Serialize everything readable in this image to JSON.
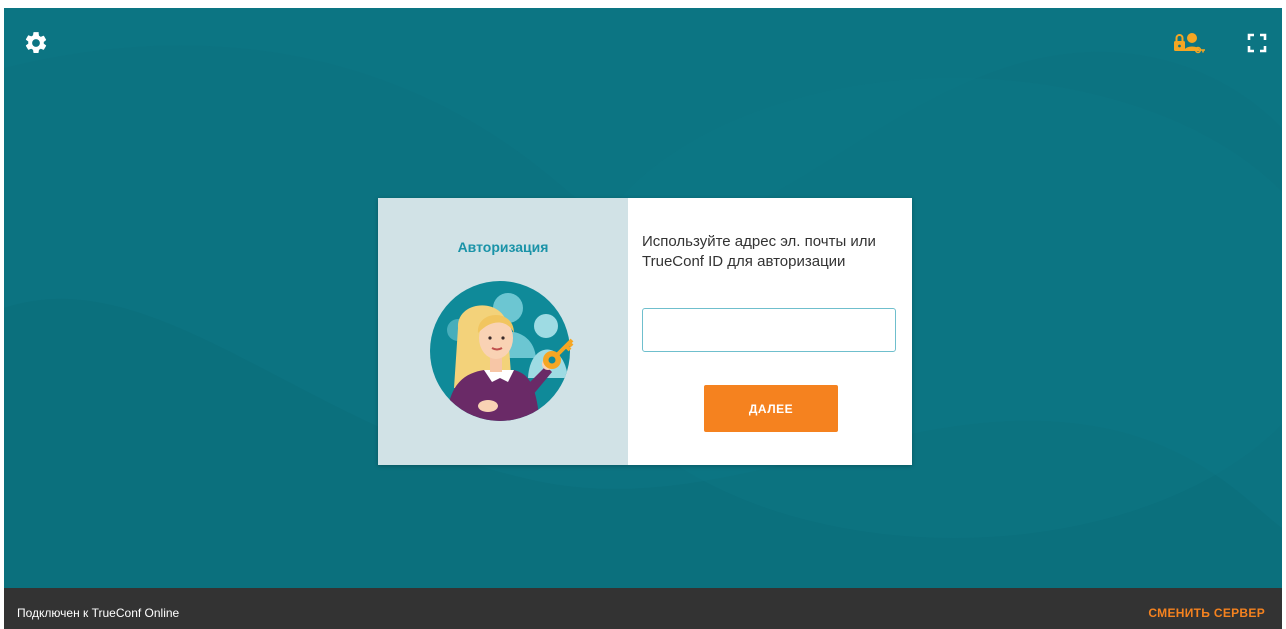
{
  "colors": {
    "background": "#0c7381",
    "accent": "#f5821f",
    "card_left_bg": "#d1e2e6",
    "title_color": "#1a93a8",
    "status_bar": "#333333",
    "lock_icon": "#f5a623"
  },
  "icons": {
    "settings": "gear-icon",
    "lock": "lock-user-key-icon",
    "fullscreen": "fullscreen-icon"
  },
  "login": {
    "title": "Авторизация",
    "instruction": "Используйте адрес эл. почты или TrueConf ID для авторизации",
    "input_value": "",
    "next_label": "ДАЛЕЕ"
  },
  "status": {
    "connection_text": "Подключен к TrueConf Online",
    "change_server_label": "СМЕНИТЬ СЕРВЕР"
  }
}
